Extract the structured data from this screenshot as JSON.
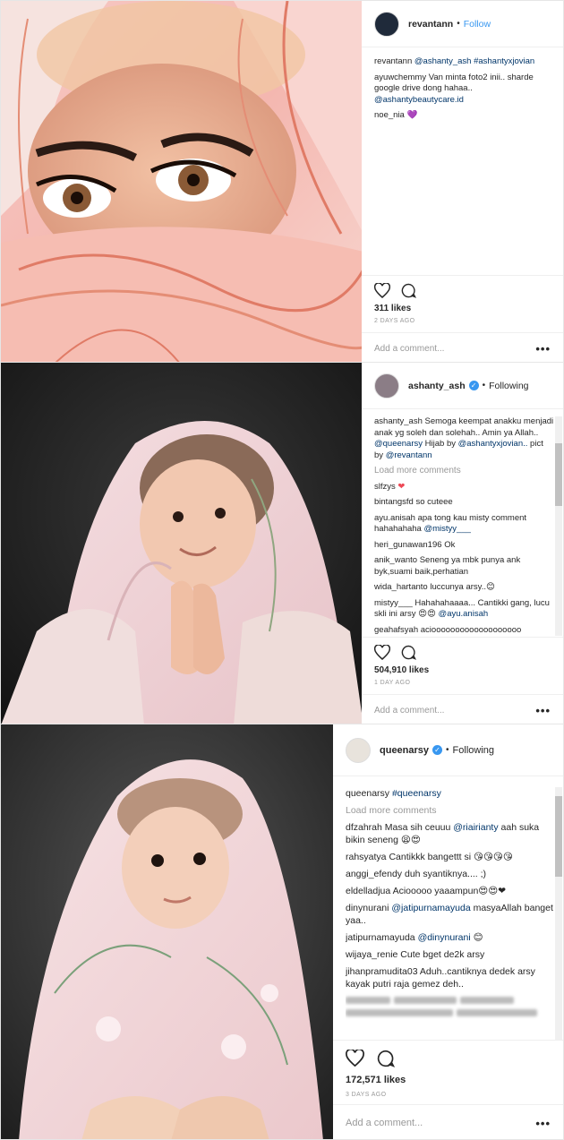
{
  "posts": [
    {
      "username": "revantann",
      "follow_label": "Follow",
      "comments": [
        {
          "user": "revantann",
          "text": "",
          "mentions": "@ashanty_ash #ashantyxjovian"
        },
        {
          "user": "ayuwchemmy",
          "text": "Van minta foto2 inii.. sharde google drive dong hahaa..",
          "mentions": "@ashantybeautycare.id"
        },
        {
          "user": "noe_nia",
          "text": "💜",
          "mentions": ""
        }
      ],
      "likes": "311 likes",
      "date": "2 DAYS AGO",
      "add_comment": "Add a comment..."
    },
    {
      "username": "ashanty_ash",
      "follow_label": "Following",
      "caption_user": "ashanty_ash",
      "caption": "Semoga keempat anakku menjadi anak yg soleh dan solehah.. Amin ya Allah..",
      "caption_mention1": "@queenarsy",
      "caption_mid": "Hijab by",
      "caption_mention2": "@ashantyxjovian..",
      "caption_pict": "pict by",
      "caption_mention3": "@revantann",
      "load_more": "Load more comments",
      "comments": [
        {
          "user": "slfzys",
          "text": "❤"
        },
        {
          "user": "bintangsfd",
          "text": "so cuteee"
        },
        {
          "user": "ayu.anisah",
          "text": "apa tong kau misty comment hahahahaha",
          "mention": "@mistyy___"
        },
        {
          "user": "heri_gunawan196",
          "text": "Ok"
        },
        {
          "user": "anik_wanto",
          "text": "Seneng ya mbk punya ank byk,suami baik,perhatian"
        },
        {
          "user": "wida_hartanto",
          "text": "luccunya arsy..😊"
        },
        {
          "user": "mistyy___",
          "text": "Hahahahaaaa... Cantikki gang, lucu skli ini arsy 😍😍",
          "mention": "@ayu.anisah"
        },
        {
          "user": "geahafsyah",
          "text": "aciooooooooooooooooooo"
        }
      ],
      "likes": "504,910 likes",
      "date": "1 DAY AGO",
      "add_comment": "Add a comment..."
    },
    {
      "username": "queenarsy",
      "follow_label": "Following",
      "caption_user": "queenarsy",
      "caption_tag": "#queenarsy",
      "load_more": "Load more comments",
      "comments": [
        {
          "user": "dfzahrah",
          "text": "Masa sih ceuuu",
          "mention": "@riairianty",
          "tail": "aah suka bikin seneng 😫😍"
        },
        {
          "user": "rahsyatya",
          "text": "Cantikkk bangettt si 😘😘😘😘"
        },
        {
          "user": "anggi_efendy",
          "text": "duh syantiknya.... ;)"
        },
        {
          "user": "eldelladjua",
          "text": "Aciooooo yaaampun😍😍❤"
        },
        {
          "user": "dinynurani",
          "text": "masyaAllah banget yaa..",
          "mention": "@jatipurnamayuda"
        },
        {
          "user": "jatipurnamayuda",
          "text": "😊",
          "mention": "@dinynurani"
        },
        {
          "user": "wijaya_renie",
          "text": "Cute bget de2k arsy"
        },
        {
          "user": "jihanpramudita03",
          "text": "Aduh..cantiknya dedek arsy kayak putri raja gemez deh.."
        }
      ],
      "likes": "172,571 likes",
      "date": "3 DAYS AGO",
      "add_comment": "Add a comment..."
    }
  ],
  "colors": {
    "link": "#003569",
    "follow": "#3897f0",
    "muted": "#999999",
    "heart": "#ed4956"
  },
  "icons": [
    "heart-outline-icon",
    "comment-bubble-icon",
    "verified-badge-icon",
    "more-options-icon"
  ]
}
